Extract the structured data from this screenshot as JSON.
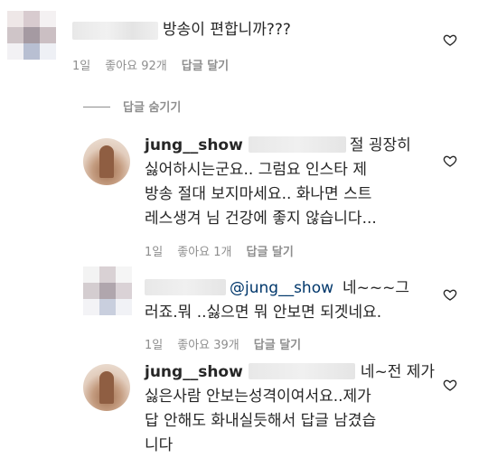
{
  "comments": [
    {
      "text_lines": [
        "방송이 편합니까???"
      ],
      "meta": {
        "time": "1일",
        "likes": "좋아요 92개",
        "reply": "답글 달기"
      }
    },
    {
      "hide_replies": "답글 숨기기"
    },
    {
      "username": "jung__show",
      "text_lines": [
        "절 굉장히",
        "싫어하시는군요.. 그럼요 인스타 제",
        "방송 절대 보지마세요.. 화나면 스트",
        "레스생겨 님 건강에 좋지 않습니다..."
      ],
      "meta": {
        "time": "1일",
        "likes": "좋아요 1개",
        "reply": "답글 달기"
      }
    },
    {
      "mention": "@jung__show",
      "text_lines": [
        "네~~~그",
        "러죠.뭐 ..싫으면 뭐 안보면 되겟네요."
      ],
      "meta": {
        "time": "1일",
        "likes": "좋아요 39개",
        "reply": "답글 달기"
      }
    },
    {
      "username": "jung__show",
      "text_lines": [
        "네~전 제가",
        "싫은사람 안보는성격이여서요..제가",
        "답 안해도 화내실듯해서 답글 남겼습",
        "니다"
      ]
    }
  ],
  "colors": {
    "text": "#262626",
    "meta": "#8e8e8e",
    "mention": "#00376b"
  },
  "icons": [
    "heart-outline-icon"
  ]
}
